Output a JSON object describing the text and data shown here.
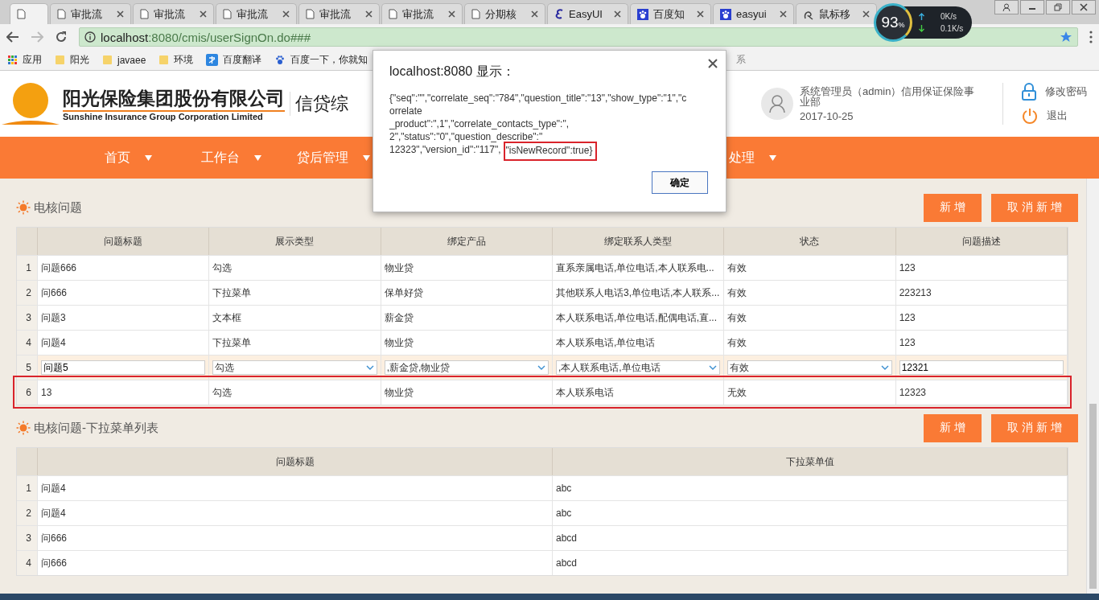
{
  "browser": {
    "tabs": [
      {
        "selected": true,
        "kind": "page"
      },
      {
        "title": "审批流",
        "selected": false,
        "kind": "page"
      },
      {
        "title": "审批流",
        "selected": false,
        "kind": "page"
      },
      {
        "title": "审批流",
        "selected": false,
        "kind": "page"
      },
      {
        "title": "审批流",
        "selected": false,
        "kind": "page"
      },
      {
        "title": "审批流",
        "selected": false,
        "kind": "page"
      },
      {
        "title": "分期核",
        "selected": false,
        "kind": "page"
      },
      {
        "title": "EasyUI",
        "selected": false,
        "kind": "script"
      },
      {
        "title": "百度知",
        "selected": false,
        "kind": "paw"
      },
      {
        "title": "easyui",
        "selected": false,
        "kind": "paw"
      },
      {
        "title": "鼠标移",
        "selected": false,
        "kind": "swirl"
      }
    ],
    "address": {
      "host": "localhost",
      "rest": ":8080/cmis/userSignOn.do###"
    },
    "bookmarks": [
      {
        "label": "应用",
        "kind": "apps"
      },
      {
        "label": "阳光",
        "kind": "folder"
      },
      {
        "label": "javaee",
        "kind": "folder"
      },
      {
        "label": "环境",
        "kind": "folder"
      },
      {
        "label": "百度翻译",
        "kind": "translate"
      },
      {
        "label": "百度一下，你就知",
        "kind": "paw"
      }
    ],
    "bookmark_tail": "系",
    "net_widget": {
      "percent": "93",
      "percent_sign": "%",
      "up": "0K/s",
      "down": "0.1K/s"
    }
  },
  "header": {
    "company_cn": "阳光保险集团股份有限公司",
    "company_en": "Sunshine Insurance Group Corporation Limited",
    "system_name": "信贷综",
    "user": "系统管理员（admin）信用保证保险事业部",
    "date": "2017-10-25",
    "links": [
      {
        "label": "修改密码",
        "kind": "lock"
      },
      {
        "label": "退出",
        "kind": "power"
      }
    ]
  },
  "nav": {
    "items": [
      "首页",
      "工作台",
      "贷后管理"
    ],
    "tail": "处理"
  },
  "sections": [
    {
      "title": "电核问题",
      "buttons": [
        "新 增",
        "取 消 新 增"
      ],
      "columns": [
        "问题标题",
        "展示类型",
        "绑定产品",
        "绑定联系人类型",
        "状态",
        "问题描述"
      ],
      "rows": [
        {
          "kind": "plain",
          "outlined": false,
          "num": "1",
          "cells": [
            "问题666",
            "勾选",
            "物业贷",
            "直系亲属电话,单位电话,本人联系电...",
            "有效",
            "123"
          ]
        },
        {
          "kind": "plain",
          "outlined": false,
          "num": "2",
          "cells": [
            "问666",
            "下拉菜单",
            "保单好贷",
            "其他联系人电话3,单位电话,本人联系...",
            "有效",
            "223213"
          ]
        },
        {
          "kind": "plain",
          "outlined": false,
          "num": "3",
          "cells": [
            "问题3",
            "文本框",
            "薪金贷",
            "本人联系电话,单位电话,配偶电话,直...",
            "有效",
            "123"
          ]
        },
        {
          "kind": "plain",
          "outlined": false,
          "num": "4",
          "cells": [
            "问题4",
            "下拉菜单",
            "物业贷",
            "本人联系电话,单位电话",
            "有效",
            "123"
          ]
        },
        {
          "kind": "edit",
          "outlined": false,
          "num": "5",
          "cells": [
            "问题5",
            "勾选",
            ",薪金贷,物业贷",
            ",本人联系电话,单位电话",
            "有效",
            "12321"
          ]
        },
        {
          "kind": "plain",
          "outlined": true,
          "num": "6",
          "cells": [
            "13",
            "勾选",
            "物业贷",
            "本人联系电话",
            "无效",
            "12323"
          ]
        }
      ]
    },
    {
      "title": "电核问题-下拉菜单列表",
      "buttons": [
        "新 增",
        "取 消 新 增"
      ],
      "columns": [
        "问题标题",
        "下拉菜单值"
      ],
      "rows": [
        {
          "kind": "plain",
          "outlined": false,
          "num": "1",
          "cells": [
            "问题4",
            "abc"
          ]
        },
        {
          "kind": "plain",
          "outlined": false,
          "num": "2",
          "cells": [
            "问题4",
            "abc"
          ]
        },
        {
          "kind": "plain",
          "outlined": false,
          "num": "3",
          "cells": [
            "问666",
            "abcd"
          ]
        },
        {
          "kind": "plain",
          "outlined": false,
          "num": "4",
          "cells": [
            "问666",
            "abcd"
          ]
        }
      ]
    }
  ],
  "dialog": {
    "title": "localhost:8080 显示：",
    "lines": [
      "{\"seq\":\"\",\"correlate_seq\":\"784\",\"question_title\":\"13\",\"show_type\":\"1\",\"c",
      "orrelate",
      "_product\":\",1\",\"correlate_contacts_type\":\",",
      "2\",\"status\":\"0\",\"question_describe\":\"",
      "12323\",\"version_id\":\"117\","
    ],
    "boxed": "\"isNewRecord\":true}",
    "ok": "确定"
  }
}
